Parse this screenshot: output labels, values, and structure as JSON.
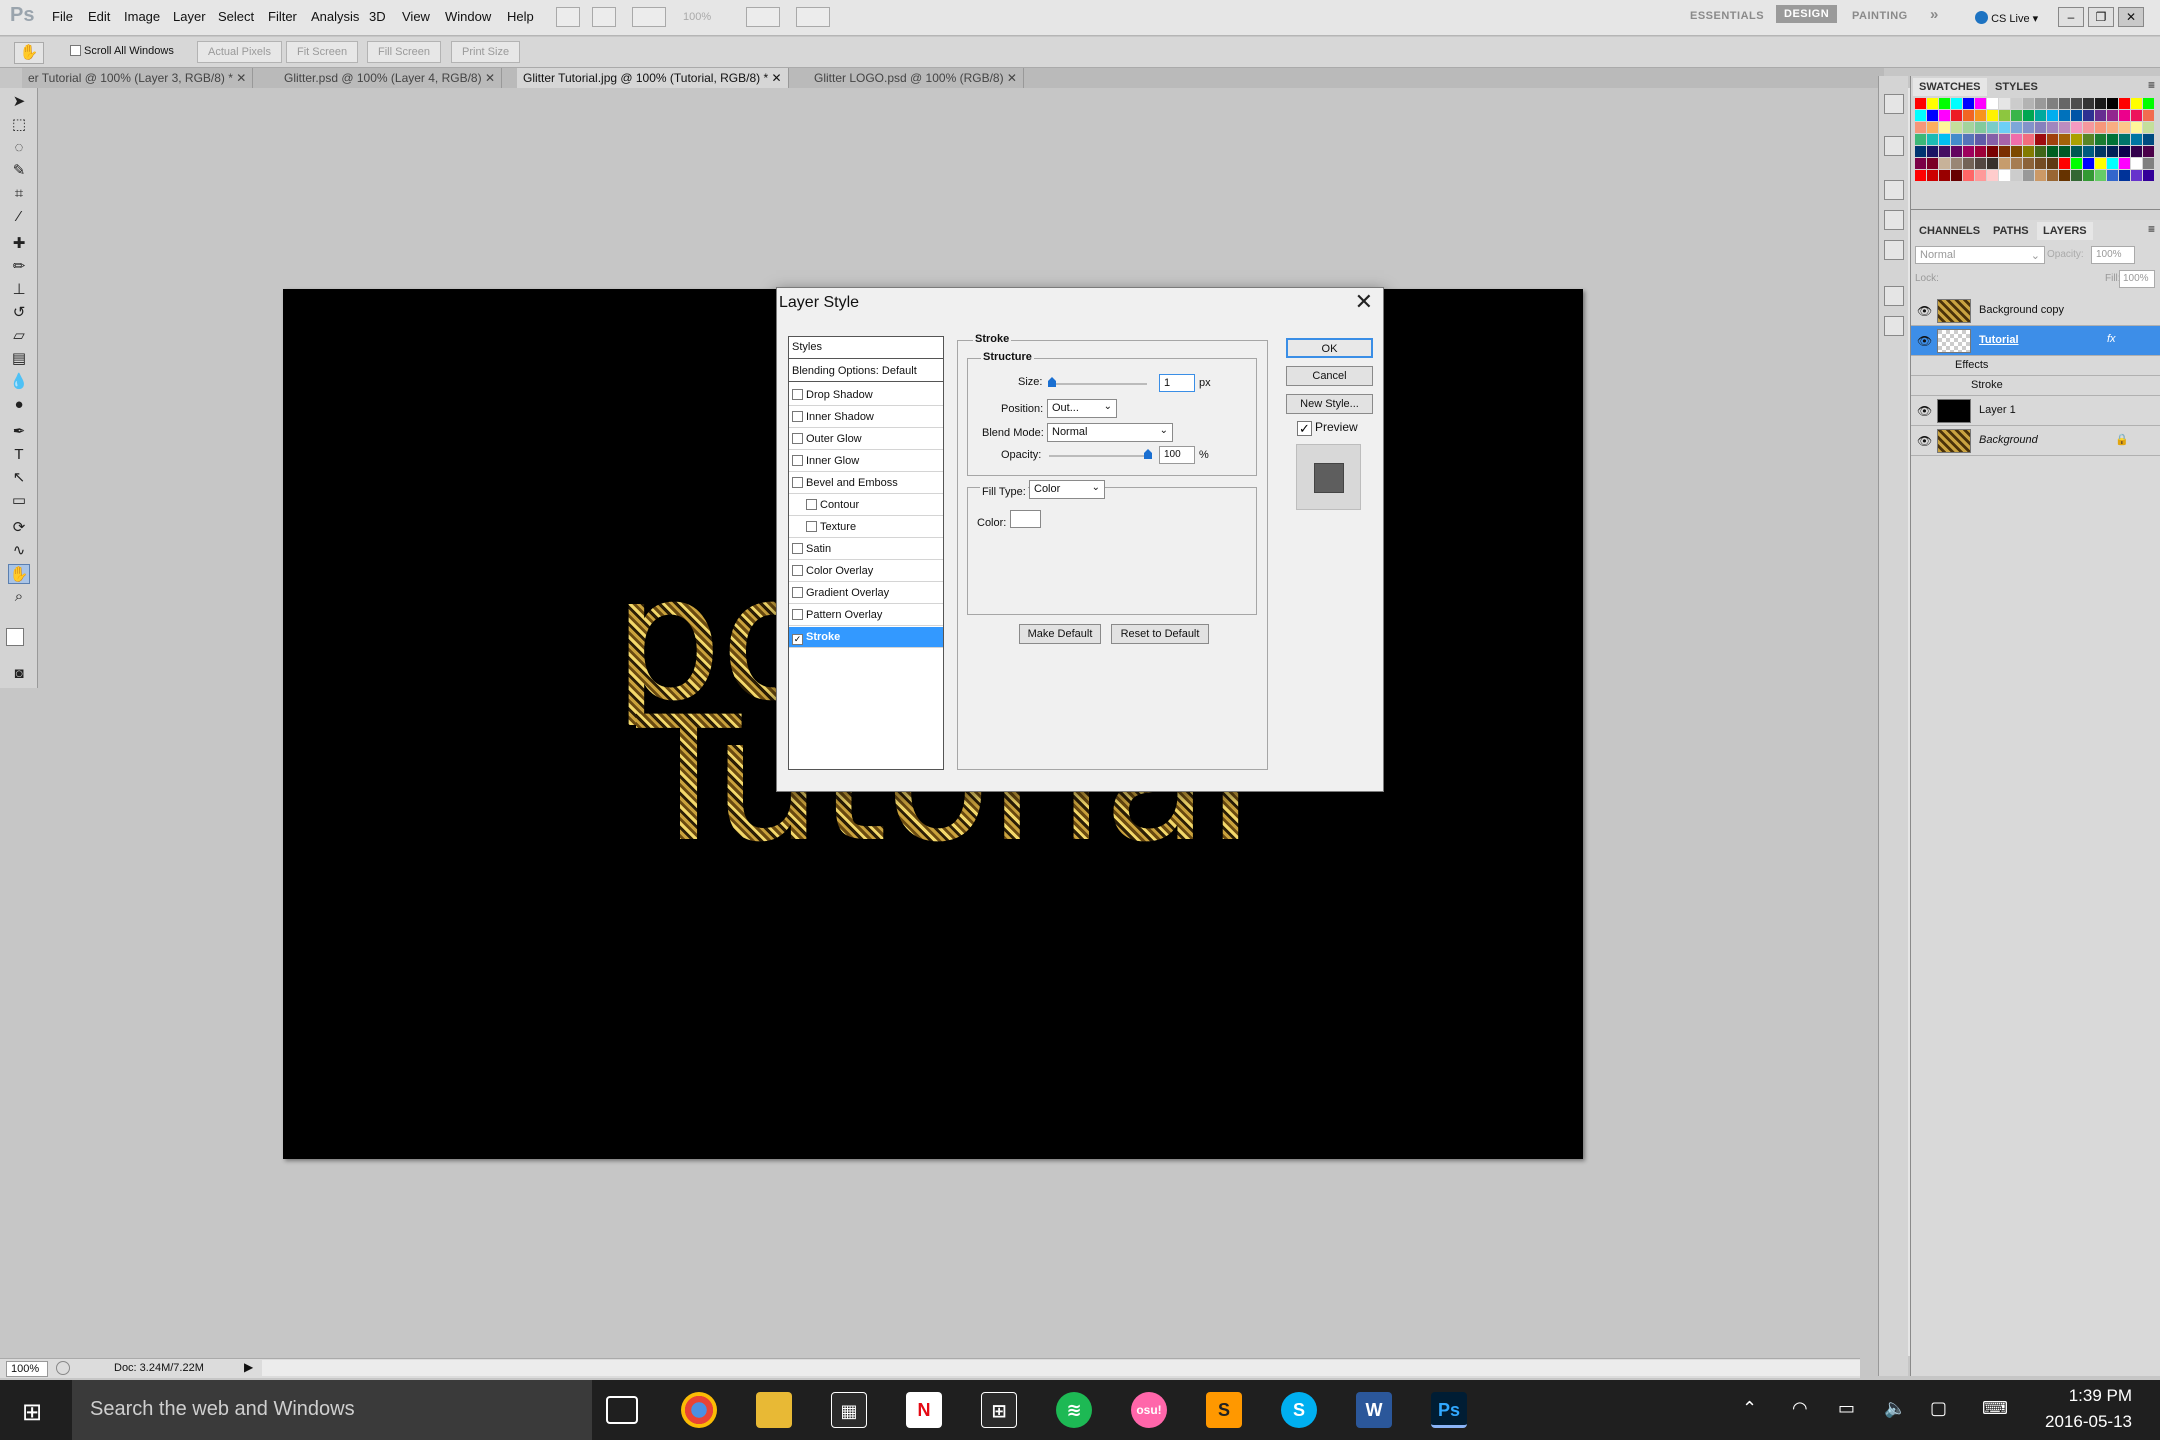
{
  "app": {
    "logo": "Ps"
  },
  "menu": [
    "File",
    "Edit",
    "Image",
    "Layer",
    "Select",
    "Filter",
    "Analysis",
    "3D",
    "View",
    "Window",
    "Help"
  ],
  "menubar": {
    "zoom": "100%",
    "workspaces": [
      "ESSENTIALS",
      "DESIGN",
      "PAINTING"
    ],
    "more": "»",
    "cs_live": "CS Live"
  },
  "options": {
    "scroll_all": "Scroll All Windows",
    "buttons": [
      "Actual Pixels",
      "Fit Screen",
      "Fill Screen",
      "Print Size"
    ]
  },
  "tabs": [
    {
      "label": "er Tutorial  @ 100% (Layer 3, RGB/8) *",
      "active": false
    },
    {
      "label": "Glitter.psd @ 100% (Layer 4, RGB/8)",
      "active": false
    },
    {
      "label": "Glitter Tutorial.jpg @ 100% (Tutorial, RGB/8) *",
      "active": true
    },
    {
      "label": "Glitter LOGO.psd @ 100% (RGB/8)",
      "active": false
    }
  ],
  "canvas": {
    "line1": "po",
    "line2": "Tutorial"
  },
  "status": {
    "zoom": "100%",
    "doc": "Doc: 3.24M/7.22M"
  },
  "dialog": {
    "title": "Layer Style",
    "list": [
      {
        "label": "Styles",
        "checkbox": false,
        "checked": false,
        "header": true
      },
      {
        "label": "Blending Options: Default",
        "checkbox": false,
        "checked": false,
        "header": true
      },
      {
        "label": "Drop Shadow",
        "checkbox": true,
        "checked": false
      },
      {
        "label": "Inner Shadow",
        "checkbox": true,
        "checked": false
      },
      {
        "label": "Outer Glow",
        "checkbox": true,
        "checked": false
      },
      {
        "label": "Inner Glow",
        "checkbox": true,
        "checked": false
      },
      {
        "label": "Bevel and Emboss",
        "checkbox": true,
        "checked": false
      },
      {
        "label": "Contour",
        "checkbox": true,
        "checked": false,
        "indent": true
      },
      {
        "label": "Texture",
        "checkbox": true,
        "checked": false,
        "indent": true
      },
      {
        "label": "Satin",
        "checkbox": true,
        "checked": false
      },
      {
        "label": "Color Overlay",
        "checkbox": true,
        "checked": false
      },
      {
        "label": "Gradient Overlay",
        "checkbox": true,
        "checked": false
      },
      {
        "label": "Pattern Overlay",
        "checkbox": true,
        "checked": false
      },
      {
        "label": "Stroke",
        "checkbox": true,
        "checked": true,
        "active": true
      }
    ],
    "stroke": {
      "group": "Stroke",
      "structure": "Structure",
      "size_label": "Size:",
      "size_value": "1",
      "size_unit": "px",
      "position_label": "Position:",
      "position_value": "Out...",
      "blend_label": "Blend Mode:",
      "blend_value": "Normal",
      "opacity_label": "Opacity:",
      "opacity_value": "100",
      "opacity_unit": "%",
      "filltype_label": "Fill Type:",
      "filltype_value": "Color",
      "color_label": "Color:",
      "make_default": "Make Default",
      "reset_default": "Reset to Default"
    },
    "buttons": {
      "ok": "OK",
      "cancel": "Cancel",
      "new_style": "New Style...",
      "preview": "Preview"
    }
  },
  "swatches_panel": {
    "tabs": [
      "SWATCHES",
      "STYLES"
    ]
  },
  "layers_panel": {
    "tabs": [
      "CHANNELS",
      "PATHS",
      "LAYERS"
    ],
    "blend": "Normal",
    "opacity_label": "Opacity:",
    "opacity": "100%",
    "lock_label": "Lock:",
    "fill_label": "Fill:",
    "fill": "100%",
    "layers": [
      {
        "name": "Background copy",
        "thumb": "glitter"
      },
      {
        "name": "Tutorial",
        "thumb": "transparent",
        "selected": true,
        "fx": "fx"
      },
      {
        "name": "Effects",
        "sub": true
      },
      {
        "name": "Stroke",
        "sub": true
      },
      {
        "name": "Layer 1",
        "thumb": "black"
      },
      {
        "name": "Background",
        "thumb": "glitter",
        "locked": true
      }
    ]
  },
  "taskbar": {
    "search": "Search the web and Windows",
    "time": "1:39 PM",
    "date": "2016-05-13"
  },
  "colors": {
    "accent": "#3399ff",
    "canvas": "#000000",
    "taskbar": "#1f1f1f"
  }
}
